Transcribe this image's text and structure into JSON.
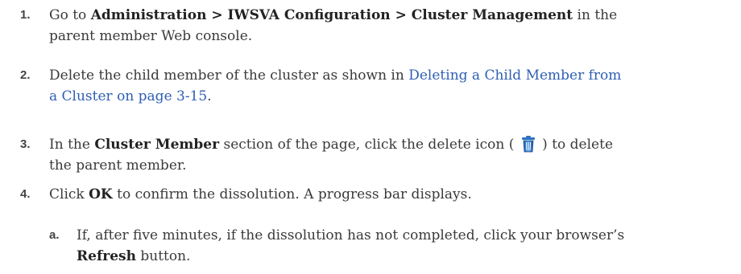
{
  "steps": [
    {
      "num": "1.",
      "pre": "Go to ",
      "bold_path": "Administration > IWSVA Configuration > Cluster Management",
      "post_line1": " in the",
      "line2": "parent member Web console."
    },
    {
      "num": "2.",
      "pre": "Delete the child member of the cluster as shown in ",
      "link_line1": "Deleting a Child Member from",
      "link_line2": "a Cluster on page 3-15",
      "post": "."
    },
    {
      "num": "3.",
      "pre": "In the ",
      "bold": "Cluster Member",
      "mid": " section of the page, click the delete icon ( ",
      "icon": "trash-icon",
      "post_line1": " ) to delete",
      "line2": "the parent member."
    },
    {
      "num": "4.",
      "pre": "Click ",
      "bold": "OK",
      "post": " to confirm the dissolution. A progress bar displays."
    }
  ],
  "substep": {
    "num": "a.",
    "line1": "If, after five minutes, if the dissolution has not completed, click your browser’s",
    "bold": "Refresh",
    "post": " button."
  },
  "colors": {
    "link": "#2e5fb3",
    "icon_blue": "#2d73c4"
  }
}
